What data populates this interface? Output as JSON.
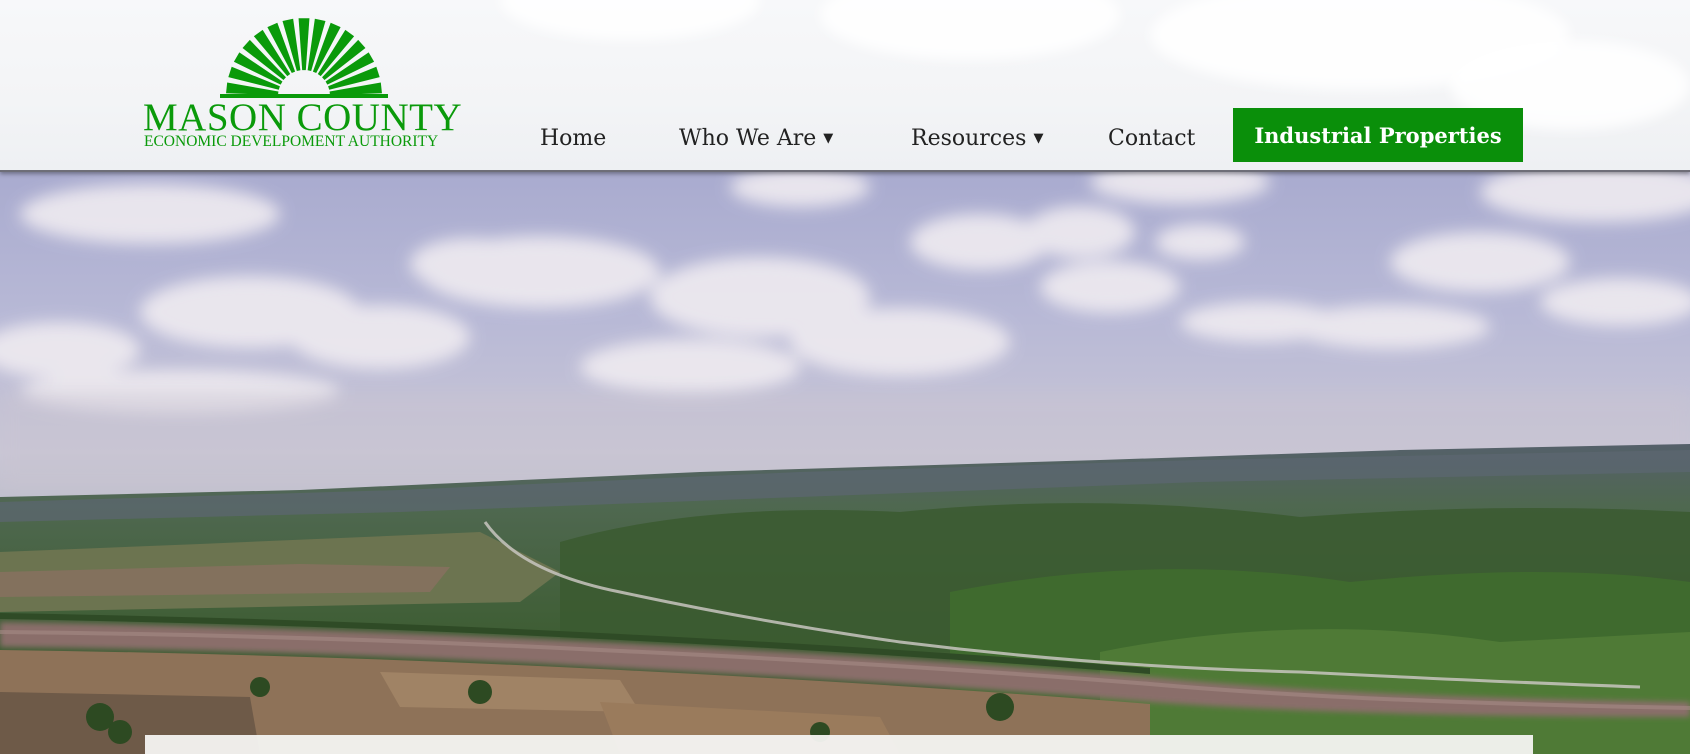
{
  "brand": {
    "name": "MASON COUNTY",
    "subtitle": "ECONOMIC DEVELPOMENT AUTHORITY",
    "logo_icon": "sunburst-logo",
    "color": "#0a9a0a"
  },
  "nav": {
    "items": [
      {
        "label": "Home",
        "has_dropdown": false
      },
      {
        "label": "Who We Are",
        "has_dropdown": true
      },
      {
        "label": "Resources",
        "has_dropdown": true
      },
      {
        "label": "Contact",
        "has_dropdown": false
      }
    ],
    "dropdown_icon": "caret-down-icon",
    "cta_label": "Industrial Properties",
    "cta_color": "#0a8f0a"
  },
  "hero": {
    "image": "aerial-river-valley-photo"
  }
}
